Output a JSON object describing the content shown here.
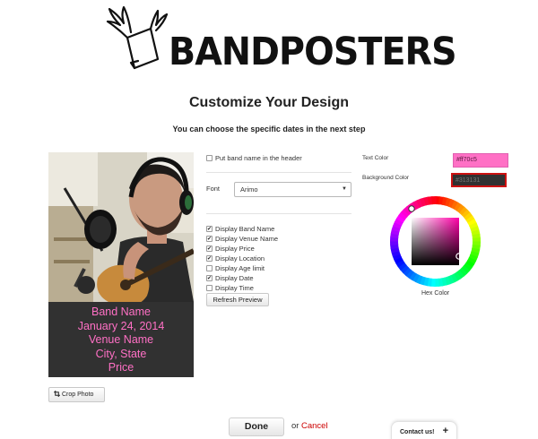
{
  "brand": {
    "name": "BANDPOSTERS",
    "logo_icon": "winged-poster-icon"
  },
  "page": {
    "title": "Customize Your Design",
    "subtitle": "You can choose the specific dates in the next step"
  },
  "poster": {
    "photo_icon": "musician-photo",
    "lines": [
      "Band Name",
      "January 24, 2014",
      "Venue Name",
      "City, State",
      "Price"
    ],
    "text_color": "#ff70c5",
    "background_color": "#313131"
  },
  "crop_button": {
    "label": "Crop Photo",
    "icon": "crop-icon"
  },
  "options": {
    "header_checkbox": {
      "label": "Put band name in the header",
      "checked": false
    },
    "font": {
      "label": "Font",
      "selected": "Arimo"
    },
    "display": [
      {
        "label": "Display Band Name",
        "checked": true
      },
      {
        "label": "Display Venue Name",
        "checked": true
      },
      {
        "label": "Display Price",
        "checked": true
      },
      {
        "label": "Display Location",
        "checked": true
      },
      {
        "label": "Display Age limit",
        "checked": false
      },
      {
        "label": "Display Date",
        "checked": true
      },
      {
        "label": "Display Time",
        "checked": false
      }
    ],
    "refresh_label": "Refresh Preview"
  },
  "colors": {
    "text_color_label": "Text Color",
    "text_color_value": "#ff70c5",
    "background_color_label": "Background Color",
    "background_color_value": "#313131",
    "picker_label": "Hex Color"
  },
  "footer": {
    "done_label": "Done",
    "or_label": "or",
    "cancel_label": "Cancel",
    "contact_label": "Contact us!",
    "contact_icon": "plus-icon"
  }
}
